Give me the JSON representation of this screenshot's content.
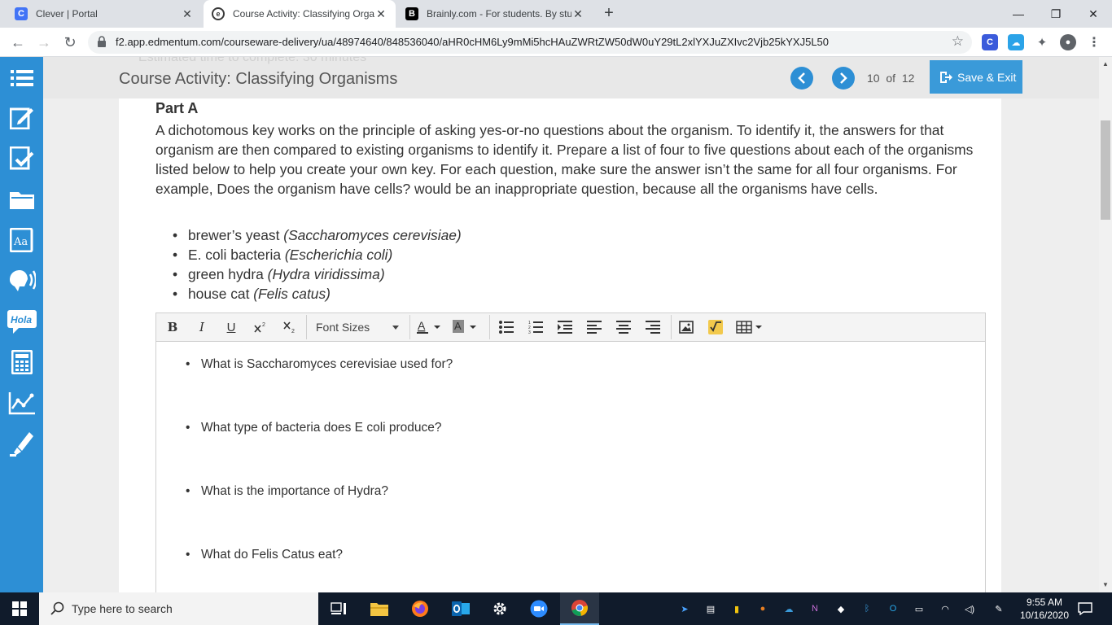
{
  "browser": {
    "tabs": [
      {
        "title": "Clever | Portal",
        "favicon": "C",
        "color": "#4274f6"
      },
      {
        "title": "Course Activity: Classifying Orga",
        "favicon": "e",
        "color": "#3a3a3a"
      },
      {
        "title": "Brainly.com - For students. By stu",
        "favicon": "B",
        "color": "#000000"
      }
    ],
    "url": "f2.app.edmentum.com/courseware-delivery/ua/48974640/848536040/aHR0cHM6Ly9mMi5hcHAuZWRtZW50dW0uY29tL2xlYXJuZXIvc2Vjb25kYXJ5L50"
  },
  "header": {
    "ghost_text": "Estimated time to complete: 30 minutes",
    "course_title": "Course Activity: Classifying Organisms",
    "page_current": "10",
    "page_of": "of",
    "page_total": "12",
    "save_exit_label": "Save & Exit"
  },
  "content": {
    "part_title": "Part A",
    "paragraph": "A dichotomous key works on the principle of asking yes-or-no questions about the organism. To identify it, the answers for that organism are then compared to existing organisms to identify it. Prepare a list of four to five questions about each of the organisms listed below to help you create your own key. For each question, make sure the answer isn’t the same for all four organisms. For example, Does the organism have cells? would be an inappropriate question, because all the organisms have cells.",
    "organisms": [
      {
        "name": "brewer’s yeast ",
        "sci": "(Saccharomyces cerevisiae)"
      },
      {
        "name": "E. coli bacteria ",
        "sci": "(Escherichia coli)"
      },
      {
        "name": "green hydra ",
        "sci": "(Hydra viridissima)"
      },
      {
        "name": "house cat ",
        "sci": "(Felis catus)"
      }
    ]
  },
  "editor": {
    "toolbar": {
      "bold": "B",
      "italic": "I",
      "underline": "U",
      "font_sizes": "Font Sizes"
    },
    "answers": [
      "What is Saccharomyces cerevisiae used for?",
      "What type of bacteria does E coli produce?",
      "What is the importance of Hydra?",
      "What do Felis Catus eat?"
    ]
  },
  "taskbar": {
    "search_placeholder": "Type here to search",
    "time": "9:55 AM",
    "date": "10/16/2020"
  },
  "colors": {
    "accent": "#2d8fd5",
    "save_button": "#3a9ad9",
    "taskbar": "#101b2b"
  }
}
